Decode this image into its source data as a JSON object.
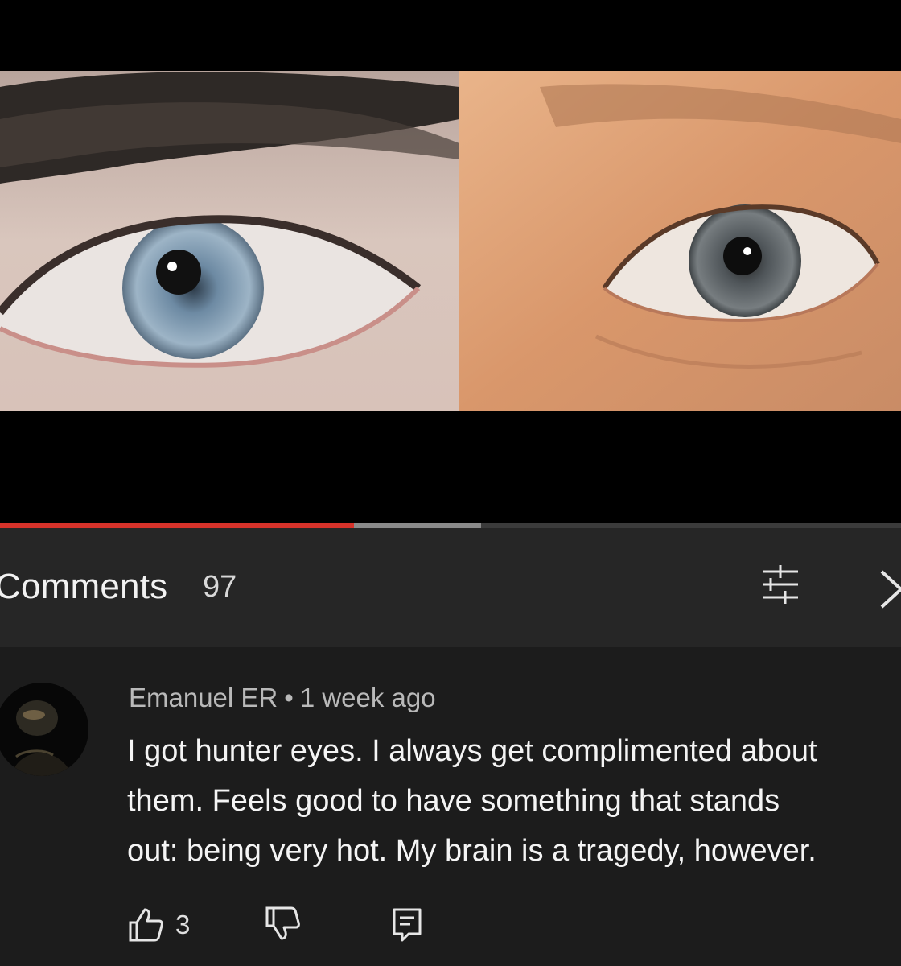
{
  "video": {
    "progress_played_fraction": 0.393,
    "progress_buffered_fraction": 0.534
  },
  "comments_header": {
    "title": "Comments",
    "count": "97",
    "filter_icon": "sort-filter-icon",
    "next_icon": "chevron-right-icon"
  },
  "comment": {
    "author": "Emanuel ER",
    "separator": "•",
    "timestamp": "1 week ago",
    "text_lines": [
      "I got hunter eyes. I always get complimented about",
      "them. Feels good to have something that stands",
      "out: being very hot. My brain is a tragedy, however."
    ],
    "likes": "3",
    "icons": {
      "like": "thumbs-up-icon",
      "dislike": "thumbs-down-icon",
      "reply": "reply-icon"
    }
  },
  "colors": {
    "progress_played": "#d6322a",
    "header_bg": "#262626",
    "comment_bg": "#1c1c1c"
  }
}
